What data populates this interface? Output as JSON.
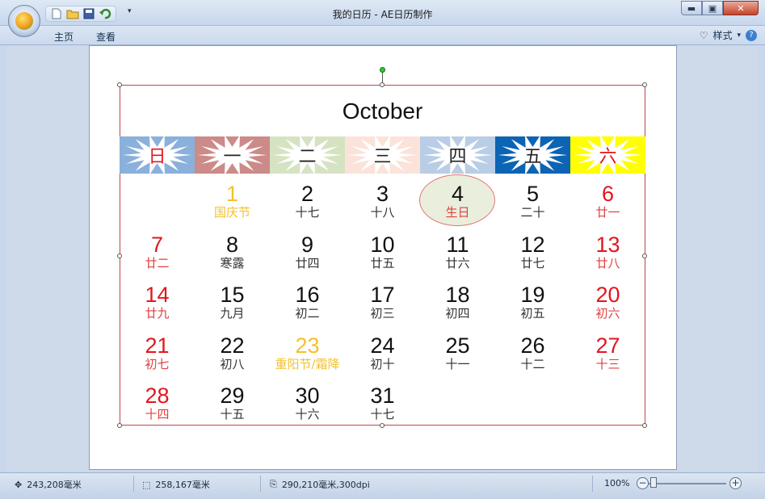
{
  "window": {
    "title": "我的日历 - AE日历制作",
    "minimize": "▬",
    "maximize": "▣",
    "close": "✕"
  },
  "ribbon": {
    "tabs": [
      "主页",
      "查看"
    ],
    "style_menu": "样式",
    "help": "?"
  },
  "calendar": {
    "month": "October",
    "weekdays": [
      {
        "label": "日",
        "bg": "#8ab0dc",
        "text": "#e2161e"
      },
      {
        "label": "一",
        "bg": "#cc8a88",
        "text": "#222"
      },
      {
        "label": "二",
        "bg": "#d6e3c2",
        "text": "#222"
      },
      {
        "label": "三",
        "bg": "#fbe3da",
        "text": "#222"
      },
      {
        "label": "四",
        "bg": "#b9cde6",
        "text": "#222"
      },
      {
        "label": "五",
        "bg": "#0b64b4",
        "text": "#222"
      },
      {
        "label": "六",
        "bg": "#ffff00",
        "text": "#e2161e"
      }
    ],
    "weeks": [
      [
        null,
        {
          "num": "1",
          "sub": "国庆节",
          "numColor": "gold",
          "subColor": "gold"
        },
        {
          "num": "2",
          "sub": "十七",
          "numColor": "black",
          "subColor": "gray"
        },
        {
          "num": "3",
          "sub": "十八",
          "numColor": "black",
          "subColor": "gray"
        },
        {
          "num": "4",
          "sub": "生日",
          "numColor": "black",
          "subColor": "red",
          "highlight": true
        },
        {
          "num": "5",
          "sub": "二十",
          "numColor": "black",
          "subColor": "gray"
        },
        {
          "num": "6",
          "sub": "廿一",
          "numColor": "red",
          "subColor": "red"
        }
      ],
      [
        {
          "num": "7",
          "sub": "廿二",
          "numColor": "red",
          "subColor": "red"
        },
        {
          "num": "8",
          "sub": "寒露",
          "numColor": "black",
          "subColor": "gray"
        },
        {
          "num": "9",
          "sub": "廿四",
          "numColor": "black",
          "subColor": "gray"
        },
        {
          "num": "10",
          "sub": "廿五",
          "numColor": "black",
          "subColor": "gray"
        },
        {
          "num": "11",
          "sub": "廿六",
          "numColor": "black",
          "subColor": "gray"
        },
        {
          "num": "12",
          "sub": "廿七",
          "numColor": "black",
          "subColor": "gray"
        },
        {
          "num": "13",
          "sub": "廿八",
          "numColor": "red",
          "subColor": "red"
        }
      ],
      [
        {
          "num": "14",
          "sub": "廿九",
          "numColor": "red",
          "subColor": "red"
        },
        {
          "num": "15",
          "sub": "九月",
          "numColor": "black",
          "subColor": "gray"
        },
        {
          "num": "16",
          "sub": "初二",
          "numColor": "black",
          "subColor": "gray"
        },
        {
          "num": "17",
          "sub": "初三",
          "numColor": "black",
          "subColor": "gray"
        },
        {
          "num": "18",
          "sub": "初四",
          "numColor": "black",
          "subColor": "gray"
        },
        {
          "num": "19",
          "sub": "初五",
          "numColor": "black",
          "subColor": "gray"
        },
        {
          "num": "20",
          "sub": "初六",
          "numColor": "red",
          "subColor": "red"
        }
      ],
      [
        {
          "num": "21",
          "sub": "初七",
          "numColor": "red",
          "subColor": "red"
        },
        {
          "num": "22",
          "sub": "初八",
          "numColor": "black",
          "subColor": "gray"
        },
        {
          "num": "23",
          "sub": "重阳节/霜降",
          "numColor": "gold",
          "subColor": "gold"
        },
        {
          "num": "24",
          "sub": "初十",
          "numColor": "black",
          "subColor": "gray"
        },
        {
          "num": "25",
          "sub": "十一",
          "numColor": "black",
          "subColor": "gray"
        },
        {
          "num": "26",
          "sub": "十二",
          "numColor": "black",
          "subColor": "gray"
        },
        {
          "num": "27",
          "sub": "十三",
          "numColor": "red",
          "subColor": "red"
        }
      ],
      [
        {
          "num": "28",
          "sub": "十四",
          "numColor": "red",
          "subColor": "red"
        },
        {
          "num": "29",
          "sub": "十五",
          "numColor": "black",
          "subColor": "gray"
        },
        {
          "num": "30",
          "sub": "十六",
          "numColor": "black",
          "subColor": "gray"
        },
        {
          "num": "31",
          "sub": "十七",
          "numColor": "black",
          "subColor": "gray"
        },
        null,
        null,
        null
      ]
    ]
  },
  "statusbar": {
    "cursor_pos": "243,208毫米",
    "selection_size": "258,167毫米",
    "page_size": "290,210毫米,300dpi",
    "zoom": "100%",
    "zoom_out": "−",
    "zoom_in": "+"
  }
}
